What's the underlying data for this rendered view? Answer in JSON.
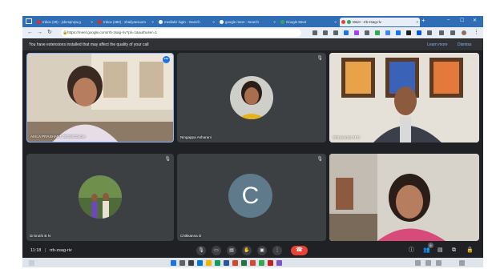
{
  "browser": {
    "tabs": [
      {
        "label": "Inbox (29) - jsbesprojw.g",
        "icon": "gmail-icon",
        "color": "#d93025"
      },
      {
        "label": "Inbox (482) - shailyaesuom",
        "icon": "gmail-icon",
        "color": "#d93025"
      },
      {
        "label": "mediatiz login - Search",
        "icon": "search-icon",
        "color": "#4285f4"
      },
      {
        "label": "google meet - Search",
        "icon": "search-icon",
        "color": "#4285f4"
      },
      {
        "label": "Google Meet",
        "icon": "meet-icon",
        "color": "#34a853"
      },
      {
        "label": "Meet - rrb-zsag-riv",
        "icon": "meet-icon",
        "color": "#34a853"
      }
    ],
    "url": "https://meet.google.com/rrb-zsag-riv?pli=1&authuser=1",
    "infobar_message": "You have extensions installed that may affect the quality of your call",
    "learn_more": "Learn more",
    "dismiss": "Dismiss"
  },
  "participants": [
    {
      "name": "AKILA PRASHANT JEGMCDuber"
    },
    {
      "name": "Ningappa Asharani"
    },
    {
      "name": "Shivakumar M G"
    },
    {
      "name": "Dr.kruthi B N"
    },
    {
      "name": "Chikkanna D",
      "initial": "C"
    },
    {
      "name": ""
    }
  ],
  "controls": {
    "time": "11:18",
    "meeting_code": "rrb-zsag-riv",
    "participant_count": "6",
    "end_call_color": "#ea4335"
  }
}
